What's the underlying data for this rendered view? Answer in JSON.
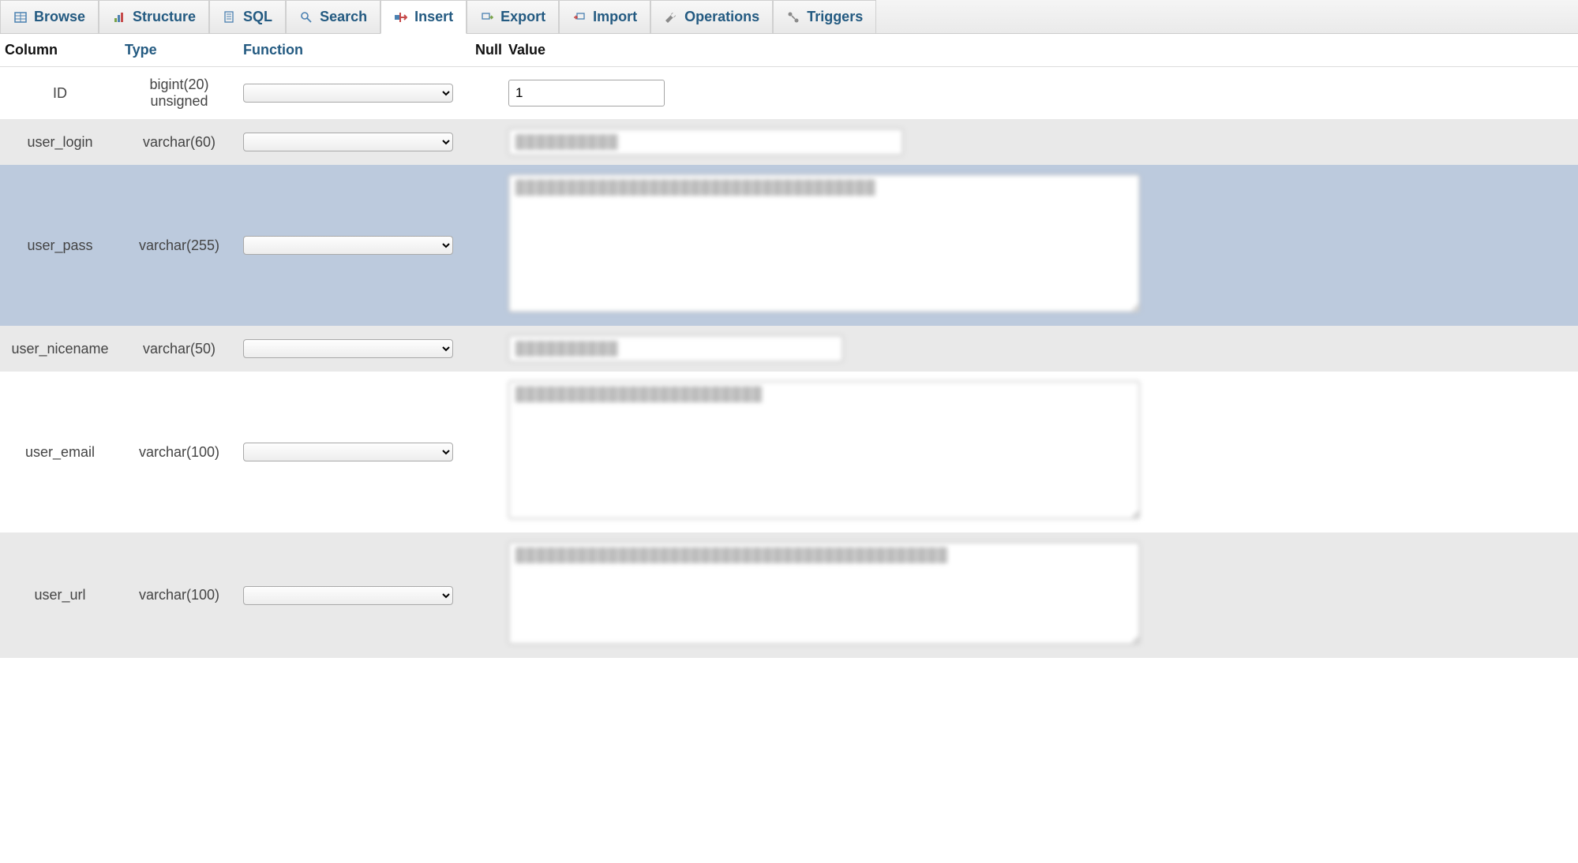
{
  "tabs": [
    {
      "label": "Browse",
      "icon": "table-icon"
    },
    {
      "label": "Structure",
      "icon": "structure-icon"
    },
    {
      "label": "SQL",
      "icon": "sql-icon"
    },
    {
      "label": "Search",
      "icon": "search-icon"
    },
    {
      "label": "Insert",
      "icon": "insert-icon",
      "active": true
    },
    {
      "label": "Export",
      "icon": "export-icon"
    },
    {
      "label": "Import",
      "icon": "import-icon"
    },
    {
      "label": "Operations",
      "icon": "wrench-icon"
    },
    {
      "label": "Triggers",
      "icon": "triggers-icon"
    }
  ],
  "headers": {
    "column": "Column",
    "type": "Type",
    "function": "Function",
    "null": "Null",
    "value": "Value"
  },
  "rows": [
    {
      "column": "ID",
      "type": "bigint(20) unsigned",
      "value": "1",
      "input": "text",
      "width": "w-198",
      "stripe": "white"
    },
    {
      "column": "user_login",
      "type": "varchar(60)",
      "value": "██████████",
      "input": "text",
      "width": "w-500",
      "stripe": "gray"
    },
    {
      "column": "user_pass",
      "type": "varchar(255)",
      "value": "███████████████████████████████████",
      "input": "textarea",
      "width": "w-800",
      "height": "h-175",
      "stripe": "blue"
    },
    {
      "column": "user_nicename",
      "type": "varchar(50)",
      "value": "██████████",
      "input": "text",
      "width": "w-424",
      "stripe": "gray"
    },
    {
      "column": "user_email",
      "type": "varchar(100)",
      "value": "████████████████████████",
      "input": "textarea",
      "width": "w-800",
      "height": "h-175",
      "stripe": "white"
    },
    {
      "column": "user_url",
      "type": "varchar(100)",
      "value": "██████████████████████████████████████████",
      "input": "textarea",
      "width": "w-800",
      "height": "h-130",
      "stripe": "gray"
    }
  ]
}
